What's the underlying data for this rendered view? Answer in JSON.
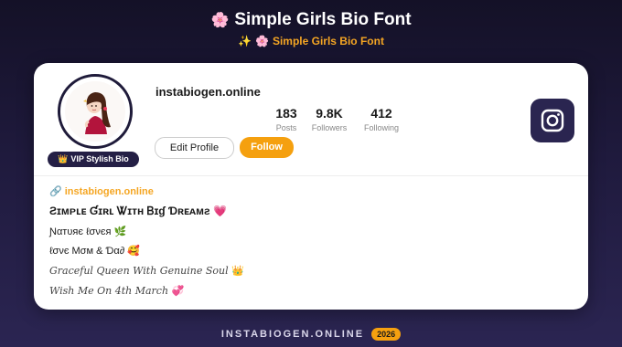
{
  "header": {
    "title": "Simple Girls Bio Font",
    "title_icon": "🌸",
    "subtitle": "Simple Girls Bio Font",
    "subtitle_spark_icon": "✨",
    "subtitle_flower_icon": "🌸"
  },
  "profile": {
    "username": "instabiogen.online",
    "badge_icon": "👑",
    "badge_label": "VIP Stylish Bio",
    "stats": [
      {
        "value": "183",
        "label": "Posts"
      },
      {
        "value": "9.8K",
        "label": "Followers"
      },
      {
        "value": "412",
        "label": "Following"
      }
    ],
    "edit_button": "Edit Profile",
    "follow_button": "Follow"
  },
  "bio": {
    "link_icon": "🔗",
    "link": "instabiogen.online",
    "lines": [
      {
        "text": "Ƨɪᴍᴘʟᴇ Ɠɪʀʟ Ꮤɪᴛʜ Ᏼɪɠ Ɗʀᴇᴀᴍƨ",
        "emoji": "💗"
      },
      {
        "text": "Ɲαтυяє ℓσνєя",
        "emoji": "🌿"
      },
      {
        "text": "ℓσνє Мσм & Ɗα∂",
        "emoji": "🥰"
      },
      {
        "text": "Graceful Queen With Genuine Soul",
        "emoji": "👑"
      },
      {
        "text": "Wish Me On 4th March",
        "emoji": "💞"
      }
    ]
  },
  "footer": {
    "site": "INSTABIOGEN.ONLINE",
    "year": "2026"
  },
  "colors": {
    "accent": "#f5a00f",
    "dark": "#241f45"
  }
}
